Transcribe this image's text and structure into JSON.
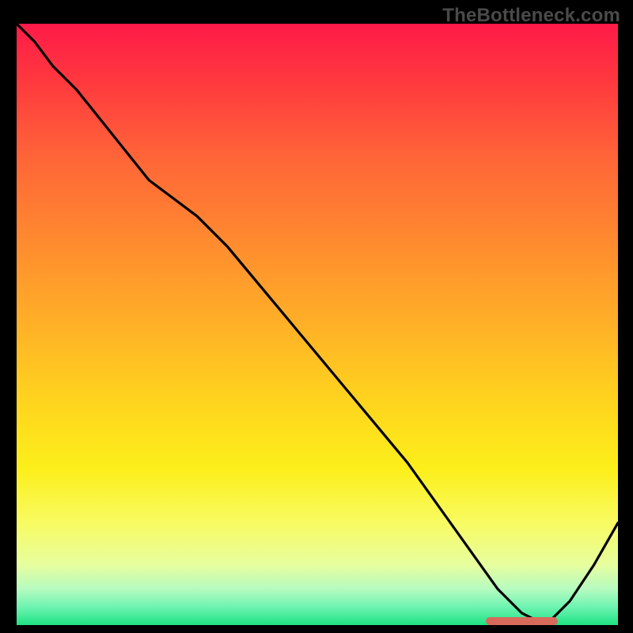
{
  "watermark": "TheBottleneck.com",
  "colors": {
    "page_bg": "#000000",
    "curve_stroke": "#000000",
    "marker_fill": "#d76a5b",
    "watermark_color": "#4a4a4a"
  },
  "chart_data": {
    "type": "line",
    "title": "",
    "xlabel": "",
    "ylabel": "",
    "xlim": [
      0,
      100
    ],
    "ylim": [
      0,
      100
    ],
    "series": [
      {
        "name": "bottleneck-curve",
        "x": [
          0,
          3,
          6,
          10,
          14,
          18,
          22,
          26,
          30,
          35,
          40,
          45,
          50,
          55,
          60,
          65,
          70,
          75,
          80,
          84,
          88,
          92,
          96,
          100
        ],
        "values": [
          100,
          97,
          93,
          89,
          84,
          79,
          74,
          71,
          68,
          63,
          57,
          51,
          45,
          39,
          33,
          27,
          20,
          13,
          6,
          2,
          0,
          4,
          10,
          17
        ]
      }
    ],
    "annotations": [
      {
        "name": "optimal-range-marker",
        "x_start": 78,
        "x_end": 90,
        "y": 0.6,
        "color": "#d76a5b"
      }
    ],
    "gradient_stops": [
      {
        "pos": 0,
        "color": "#ff1a48"
      },
      {
        "pos": 50,
        "color": "#ffb027"
      },
      {
        "pos": 74,
        "color": "#fcef1a"
      },
      {
        "pos": 100,
        "color": "#1ee383"
      }
    ]
  }
}
